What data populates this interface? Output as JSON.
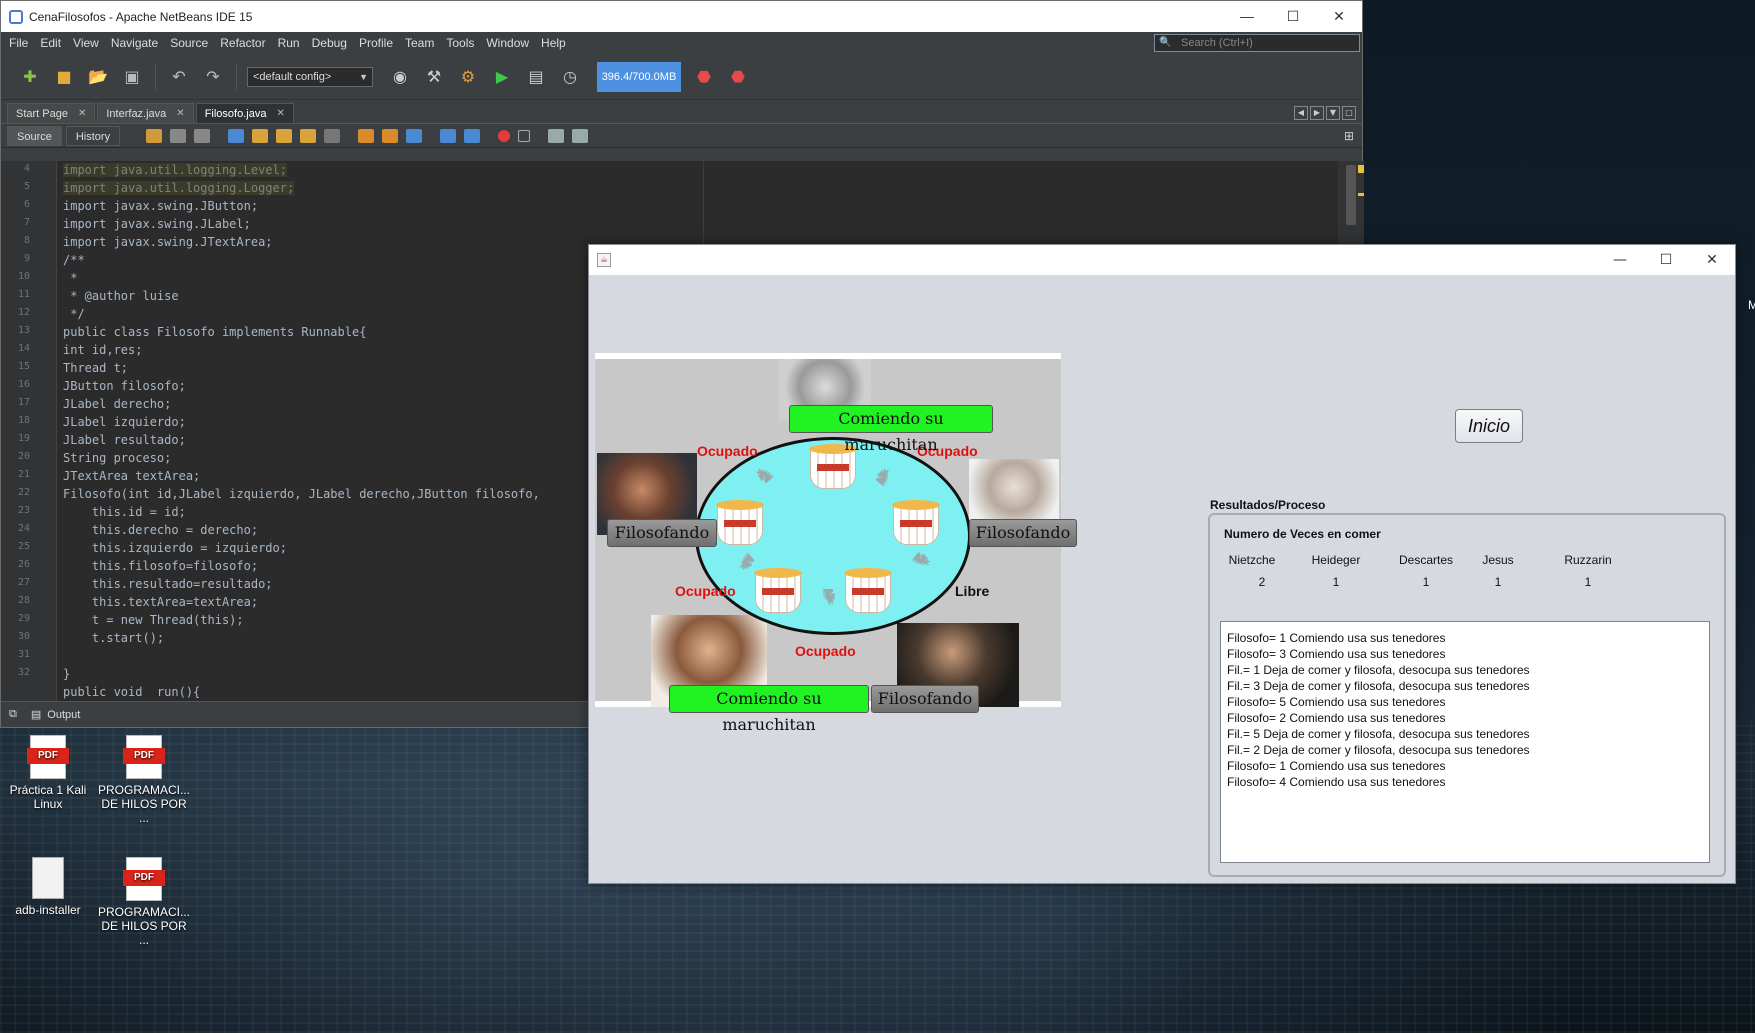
{
  "desktop": {
    "icons": [
      {
        "label": "Práctica 1 Kali Linux",
        "type": "pdf"
      },
      {
        "label": "PROGRAMACI... DE HILOS POR ...",
        "type": "pdf"
      },
      {
        "label": "adb-installer",
        "type": "file"
      },
      {
        "label": "PROGRAMACI... DE HILOS POR ...",
        "type": "pdf"
      }
    ],
    "edge_letter": "M"
  },
  "netbeans": {
    "title": "CenaFilosofos - Apache NetBeans IDE 15",
    "menu": [
      "File",
      "Edit",
      "View",
      "Navigate",
      "Source",
      "Refactor",
      "Run",
      "Debug",
      "Profile",
      "Team",
      "Tools",
      "Window",
      "Help"
    ],
    "search_placeholder": "Search (Ctrl+I)",
    "config": "<default config>",
    "memory": "396.4/700.0MB",
    "tabs": [
      {
        "label": "Start Page",
        "active": false
      },
      {
        "label": "Interfaz.java",
        "active": false
      },
      {
        "label": "Filosofo.java",
        "active": true
      }
    ],
    "source_tab": "Source",
    "history_tab": "History",
    "output_label": "Output",
    "code": [
      {
        "n": "4",
        "text": "import java.util.logging.Level;"
      },
      {
        "n": "5",
        "text": "import java.util.logging.Logger;"
      },
      {
        "n": "6",
        "text": "import javax.swing.JButton;"
      },
      {
        "n": "7",
        "text": "import javax.swing.JLabel;"
      },
      {
        "n": "8",
        "text": "import javax.swing.JTextArea;"
      },
      {
        "n": "9",
        "text": "/**"
      },
      {
        "n": "10",
        "text": " *"
      },
      {
        "n": "11",
        "text": " * @author luise"
      },
      {
        "n": "12",
        "text": " */"
      },
      {
        "n": "13",
        "text": "public class Filosofo implements Runnable{"
      },
      {
        "n": "14",
        "text": "int id,res;"
      },
      {
        "n": "15",
        "text": "Thread t;"
      },
      {
        "n": "16",
        "text": "JButton filosofo;"
      },
      {
        "n": "17",
        "text": "JLabel derecho;"
      },
      {
        "n": "18",
        "text": "JLabel izquierdo;"
      },
      {
        "n": "19",
        "text": "JLabel resultado;"
      },
      {
        "n": "20",
        "text": "String proceso;"
      },
      {
        "n": "21",
        "text": "JTextArea textArea;"
      },
      {
        "n": "22",
        "text": "Filosofo(int id,JLabel izquierdo, JLabel derecho,JButton filosofo,"
      },
      {
        "n": "23",
        "text": "    this.id = id;"
      },
      {
        "n": "24",
        "text": "    this.derecho = derecho;"
      },
      {
        "n": "25",
        "text": "    this.izquierdo = izquierdo;"
      },
      {
        "n": "26",
        "text": "    this.filosofo=filosofo;"
      },
      {
        "n": "27",
        "text": "    this.resultado=resultado;"
      },
      {
        "n": "28",
        "text": "    this.textArea=textArea;"
      },
      {
        "n": "29",
        "text": "    t = new Thread(this);"
      },
      {
        "n": "30",
        "text": "    t.start();"
      },
      {
        "n": "31",
        "text": ""
      },
      {
        "n": "32",
        "text": "}"
      },
      {
        "n": "",
        "text": "public void  run(){"
      }
    ]
  },
  "app": {
    "table": {
      "top_state": "Comiendo su maruchitan",
      "left_state": "Filosofando",
      "right_state": "Filosofando",
      "bottom_left_state": "Comiendo su maruchitan",
      "bottom_right_state": "Filosofando",
      "forks": [
        {
          "label": "Ocupado",
          "status": "occupied"
        },
        {
          "label": "Ocupado",
          "status": "occupied"
        },
        {
          "label": "Ocupado",
          "status": "occupied"
        },
        {
          "label": "Libre",
          "status": "free"
        },
        {
          "label": "Ocupado",
          "status": "occupied"
        }
      ]
    },
    "start_button": "Inicio",
    "panel_title": "Resultados/Proceso",
    "counts_title": "Numero de Veces en comer",
    "philosophers": [
      {
        "name": "Nietzche",
        "count": "2"
      },
      {
        "name": "Heideger",
        "count": "1"
      },
      {
        "name": "Descartes",
        "count": "1"
      },
      {
        "name": "Jesus",
        "count": "1"
      },
      {
        "name": "Ruzzarin",
        "count": "1"
      }
    ],
    "log": [
      "Filosofo= 1 Comiendo usa sus tenedores",
      "Filosofo= 3 Comiendo usa sus tenedores",
      "Fil.= 1 Deja de comer y filosofa, desocupa sus tenedores",
      "Fil.= 3 Deja de comer y filosofa, desocupa sus tenedores",
      "Filosofo= 5 Comiendo usa sus tenedores",
      "Filosofo= 2 Comiendo usa sus tenedores",
      "Fil.= 5 Deja de comer y filosofa, desocupa sus tenedores",
      "Fil.= 2 Deja de comer y filosofa, desocupa sus tenedores",
      "Filosofo= 1 Comiendo usa sus tenedores",
      "Filosofo= 4 Comiendo usa sus tenedores"
    ]
  }
}
